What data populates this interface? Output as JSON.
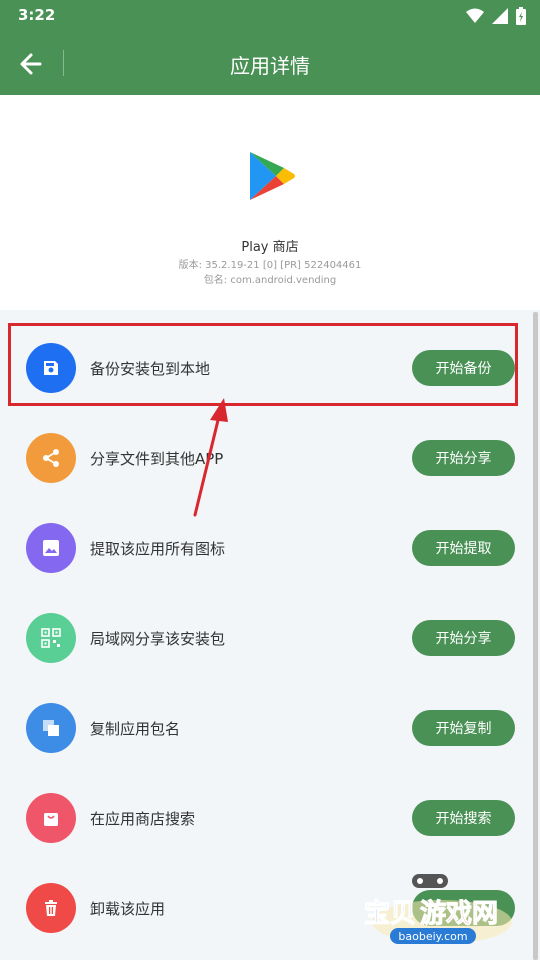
{
  "status_bar": {
    "time": "3:22"
  },
  "app_bar": {
    "title": "应用详情"
  },
  "app": {
    "name": "Play 商店",
    "version": "版本: 35.2.19-21 [0] [PR] 522404461",
    "package": "包名: com.android.vending"
  },
  "actions": [
    {
      "label": "备份安装包到本地",
      "button": "开始备份",
      "icon": "save-icon",
      "color": "#1f6ff2"
    },
    {
      "label": "分享文件到其他APP",
      "button": "开始分享",
      "icon": "share-icon",
      "color": "#f29b3c"
    },
    {
      "label": "提取该应用所有图标",
      "button": "开始提取",
      "icon": "image-icon",
      "color": "#8469f0"
    },
    {
      "label": "局域网分享该安装包",
      "button": "开始分享",
      "icon": "qr-code-icon",
      "color": "#59cf96"
    },
    {
      "label": "复制应用包名",
      "button": "开始复制",
      "icon": "copy-icon",
      "color": "#3d8de6"
    },
    {
      "label": "在应用商店搜索",
      "button": "开始搜索",
      "icon": "shopping-bag-icon",
      "color": "#f0566a"
    },
    {
      "label": "卸载该应用",
      "button": "",
      "icon": "trash-icon",
      "color": "#f04a48"
    }
  ],
  "watermark": {
    "brand": "宝贝游戏网",
    "domain": "baobeiy.com"
  },
  "colors": {
    "primary": "#4a9155",
    "highlight": "#d9272e"
  }
}
